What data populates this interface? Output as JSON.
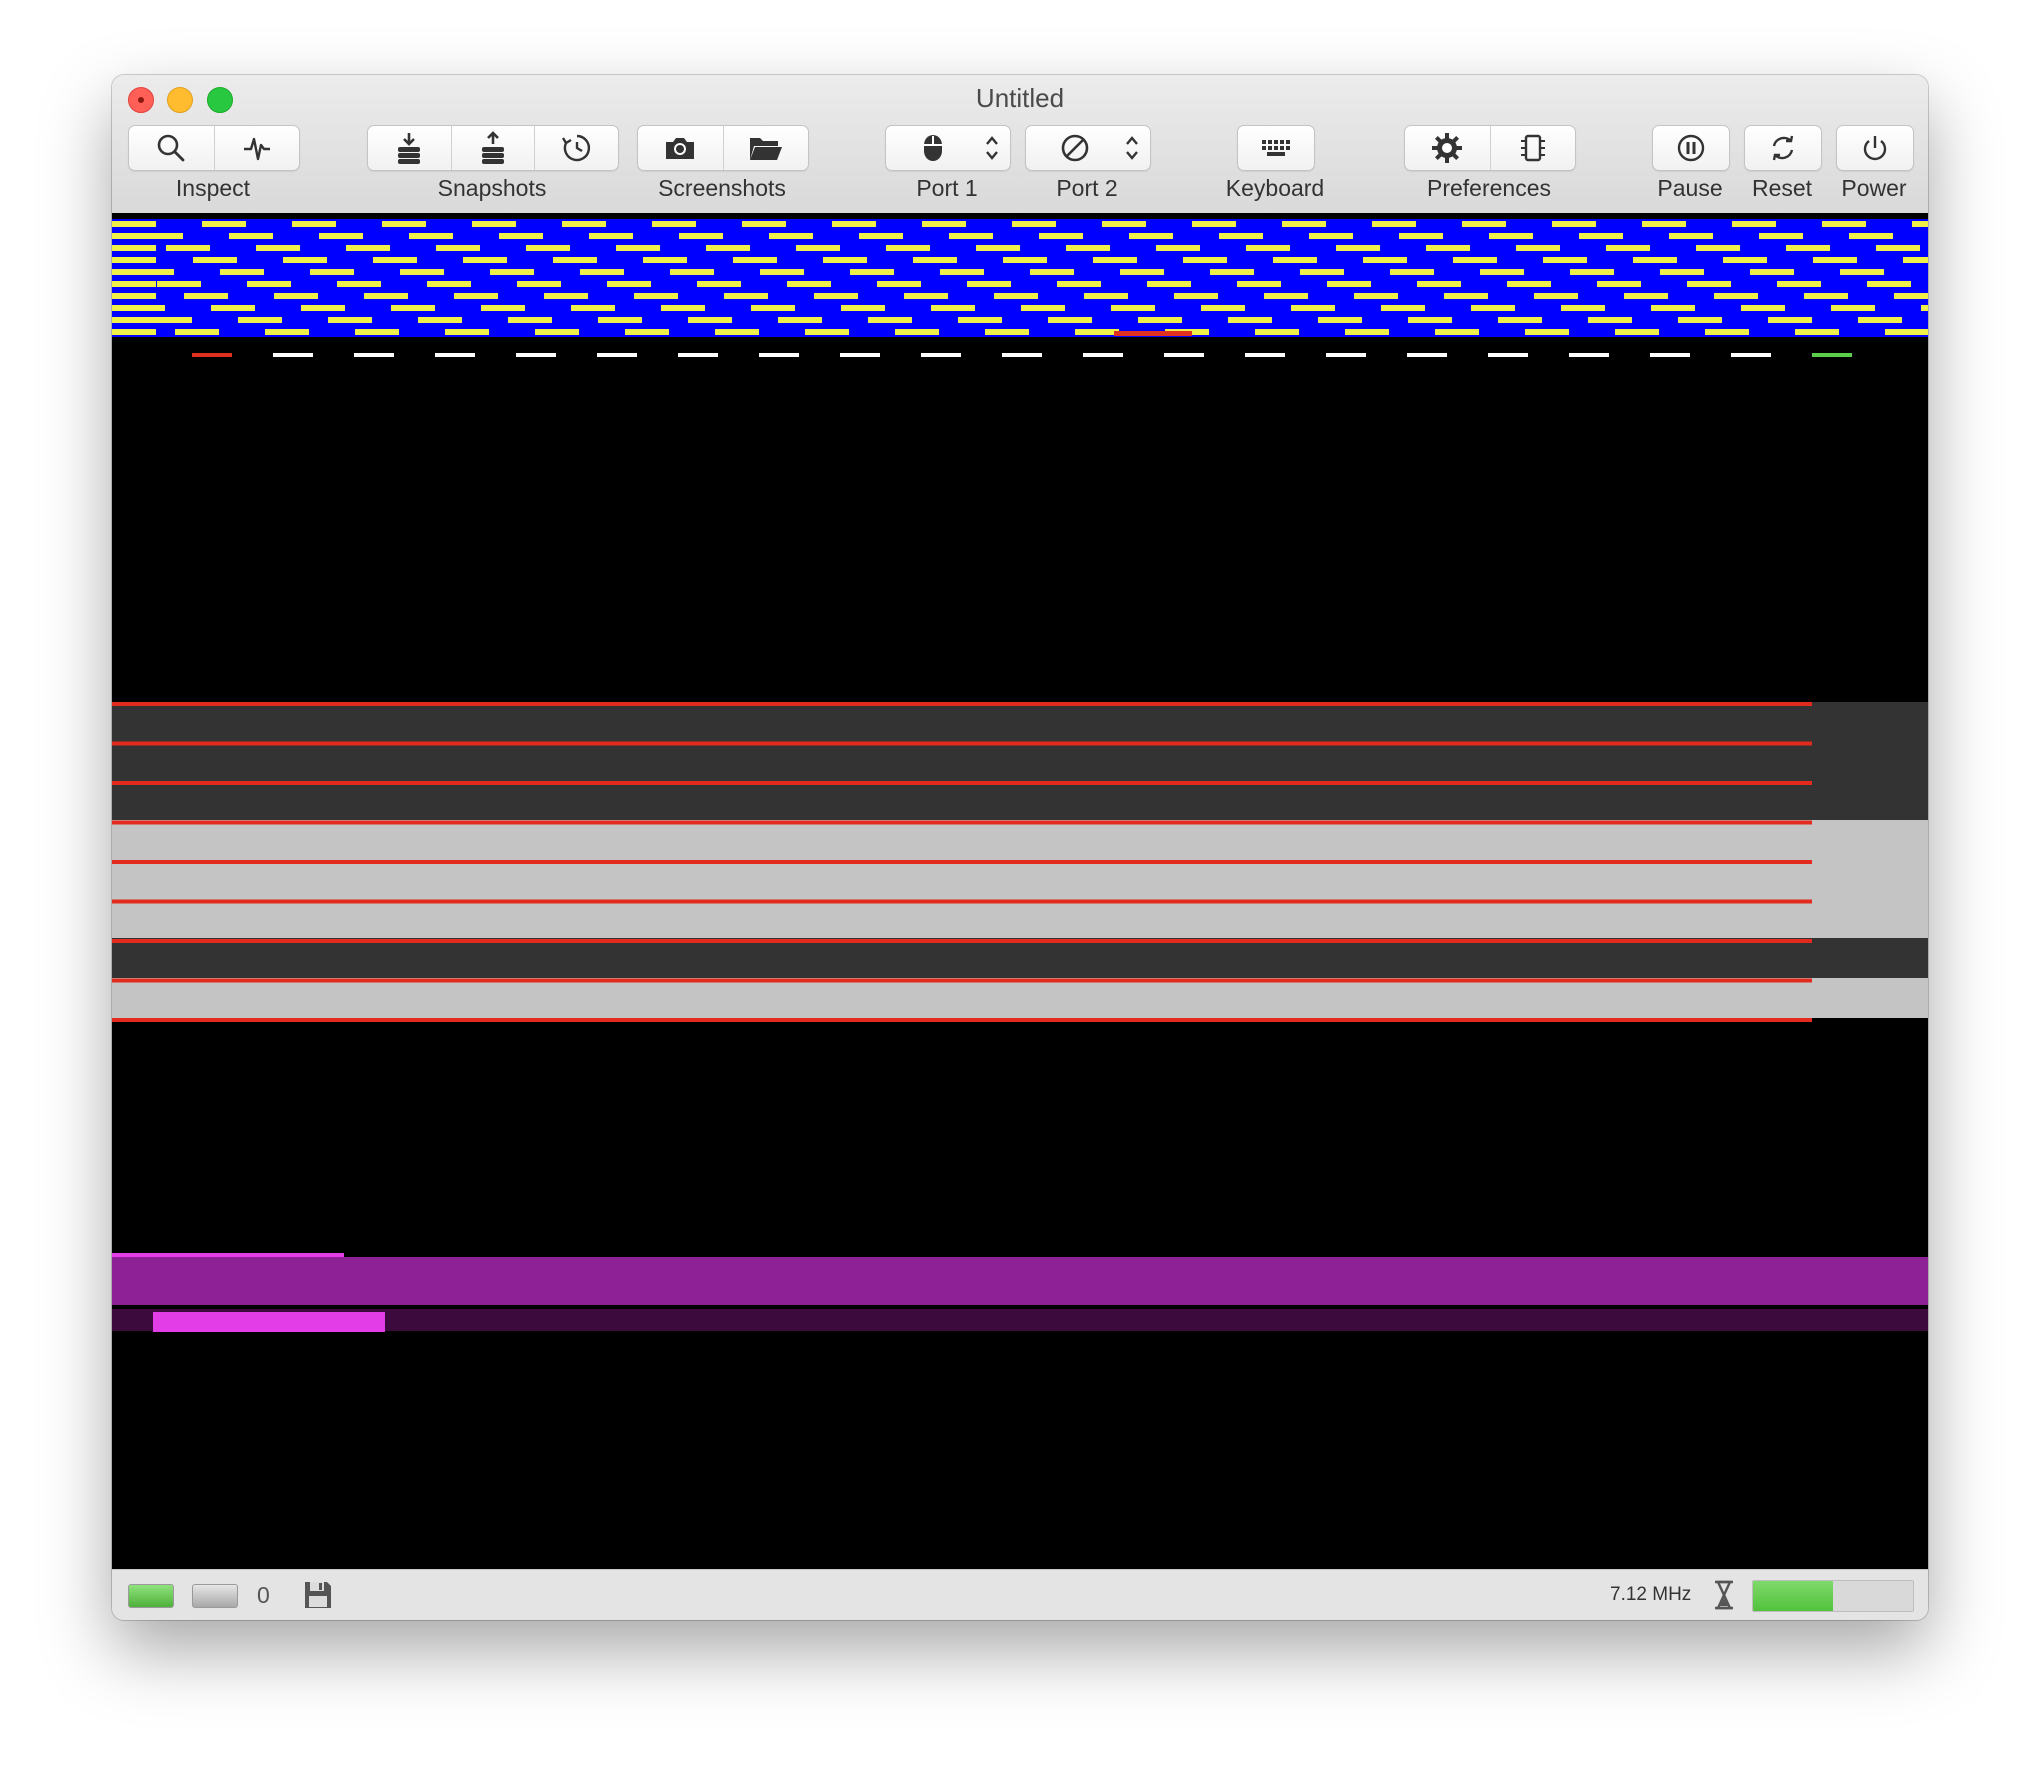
{
  "window": {
    "title": "Untitled"
  },
  "toolbar": {
    "inspect_label": "Inspect",
    "snapshots_label": "Snapshots",
    "screenshots_label": "Screenshots",
    "port1_label": "Port 1",
    "port2_label": "Port 2",
    "keyboard_label": "Keyboard",
    "preferences_label": "Preferences",
    "pause_label": "Pause",
    "reset_label": "Reset",
    "power_label": "Power",
    "icons": {
      "inspect": [
        "magnifier-icon",
        "waveform-icon"
      ],
      "snapshots": [
        "snapshot-save-icon",
        "snapshot-restore-icon",
        "snapshot-history-icon"
      ],
      "screenshots": [
        "camera-icon",
        "folder-icon"
      ],
      "port1": "mouse-icon",
      "port2": "no-device-icon",
      "keyboard": "keyboard-icon",
      "preferences": [
        "gear-icon",
        "chip-icon"
      ],
      "pause": "pause-icon",
      "reset": "reset-icon",
      "power": "power-icon"
    }
  },
  "statusbar": {
    "drive_count": "0",
    "clock": "7.12 MHz",
    "speed_fraction": 0.5,
    "drive1_led_color": "#5fc94a",
    "drive2_led_color": "#b8b8b8"
  },
  "screen_colors": {
    "background": "#000000",
    "stripe_blue": "#0000ff",
    "stripe_yellow": "#f0f04a",
    "red_line": "#e22a1e",
    "dark_band": "#333333",
    "light_band": "#c4c4c4",
    "purple_band": "#8e2196",
    "magenta_block": "#e23de6",
    "dark_purple": "#3c0a3c",
    "marker_red": "#e03020",
    "marker_white": "#ffffff",
    "marker_green": "#5ad04a"
  }
}
